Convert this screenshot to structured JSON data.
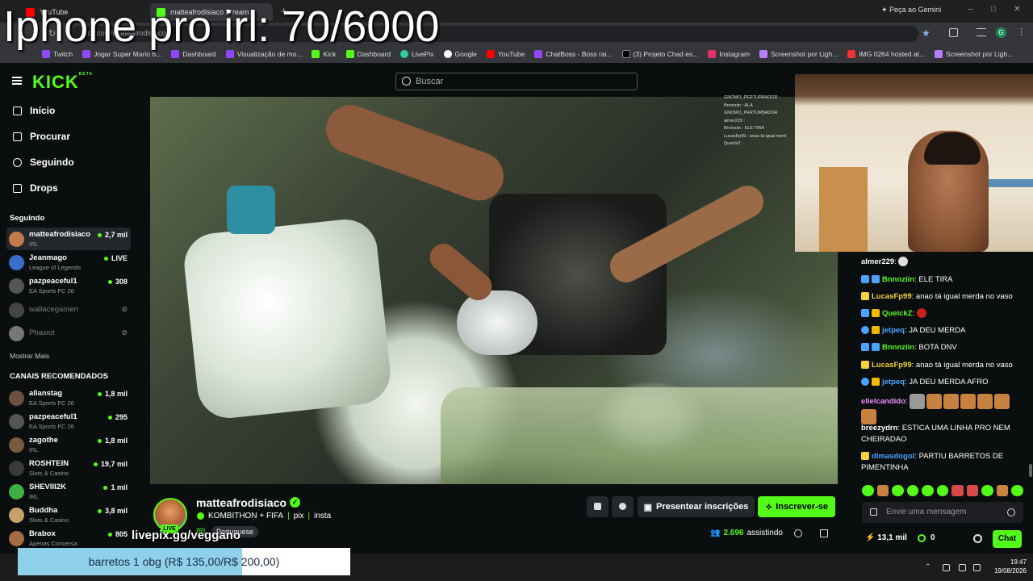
{
  "overlay_title": "Iphone pro irl: 70/6000",
  "browser": {
    "tabs": [
      {
        "label": "YouTube",
        "active": false
      },
      {
        "label": "matteafrodisiaco Stream",
        "active": true
      }
    ],
    "gemini_label": "Peça ao Gemini",
    "url": "kick.com/matteafrodisiaco",
    "bookmarks": [
      "Twitch",
      "Jogar Super Mario 6...",
      "Dashboard",
      "Visualização de mo...",
      "Kick",
      "Dashboard",
      "LivePix",
      "Google",
      "YouTube",
      "ChatBoss - Boss rai...",
      "(3) Projeto Chad es...",
      "Instagram",
      "Screenshot por Ligh...",
      "IMG 0264 hosted at...",
      "Screenshot por Ligh..."
    ]
  },
  "header": {
    "logo": "KICK",
    "logo_sup": "BETA",
    "search_placeholder": "Buscar"
  },
  "sidebar": {
    "nav": [
      {
        "label": "Início",
        "icon": "home-icon"
      },
      {
        "label": "Procurar",
        "icon": "browse-icon"
      },
      {
        "label": "Seguindo",
        "icon": "heart-icon"
      },
      {
        "label": "Drops",
        "icon": "drops-icon"
      }
    ],
    "following_title": "Seguindo",
    "following": [
      {
        "name": "matteafrodisiaco",
        "category": "IRL",
        "viewers": "2,7 mil",
        "active": true
      },
      {
        "name": "Jeanmago",
        "category": "League of Legends",
        "viewers": "LIVE"
      },
      {
        "name": "pazpeaceful1",
        "category": "EA Sports FC 26",
        "viewers": "308"
      },
      {
        "name": "wallacegamerr",
        "category": "",
        "viewers": "",
        "offline": true
      },
      {
        "name": "Phasiot",
        "category": "",
        "viewers": "",
        "offline": true
      }
    ],
    "show_more": "Mostrar Mais",
    "recommended_title": "CANAIS RECOMENDADOS",
    "recommended": [
      {
        "name": "allanstag",
        "category": "EA Sports FC 26",
        "viewers": "1,8 mil"
      },
      {
        "name": "pazpeaceful1",
        "category": "EA Sports FC 26",
        "viewers": "295"
      },
      {
        "name": "zagothe",
        "category": "IRL",
        "viewers": "1,8 mil"
      },
      {
        "name": "ROSHTEIN",
        "category": "Slots & Casino",
        "viewers": "19,7 mil"
      },
      {
        "name": "SHEVIII2K",
        "category": "IRL",
        "viewers": "1 mil"
      },
      {
        "name": "Buddha",
        "category": "Slots & Casino",
        "viewers": "3,8 mil"
      },
      {
        "name": "Brabox",
        "category": "Apenas Conversa",
        "viewers": "805"
      }
    ]
  },
  "video_overlay_chat": [
    "GNOMO_PERTURBADOR :",
    "Bnnnziin : ALA",
    "GNOMO_PERTURBADOR",
    "almer229 :",
    "Bnnnziin : ELE TIRA",
    "LucasFp99 : anao tá igual merd",
    "QueickZ :"
  ],
  "stream": {
    "streamer": "matteafrodisiaco",
    "title": "KOMBITHON + FIFA",
    "links": [
      "pix",
      "insta"
    ],
    "category": "IRL",
    "language": "Portuguese",
    "live_badge": "LIVE",
    "viewers_count": "2.696",
    "viewers_label": "assistindo",
    "gift_label": "Presentear inscrições",
    "subscribe_label": "Inscrever-se",
    "livepix_overlay": "livepix.gg/veggano"
  },
  "chat": {
    "messages": [
      {
        "user": "almer229",
        "text": "",
        "color": "#ffffff"
      },
      {
        "user": "Bnnnziin",
        "text": "ELE TIRA",
        "color": "#53fc18"
      },
      {
        "user": "LucasFp99",
        "text": "anao tá igual merda no vaso",
        "color": "#f5d33b"
      },
      {
        "user": "QueickZ",
        "text": "",
        "color": "#53fc18"
      },
      {
        "user": "jetpeq",
        "text": "JA DEU MERDA",
        "color": "#4aa3ff"
      },
      {
        "user": "Bnnnziin",
        "text": "BOTA DNV",
        "color": "#53fc18"
      },
      {
        "user": "LucasFp99",
        "text": "anao tá igual merda no vaso",
        "color": "#f5d33b"
      },
      {
        "user": "jetpeq",
        "text": "JA DEU MERDA AFRO",
        "color": "#4aa3ff"
      },
      {
        "user": "elielcandido",
        "text": "",
        "color": "#f08cff"
      },
      {
        "user": "breezydrn",
        "text": "ESTICA UMA LINHA PRO NEM CHEIRADAO",
        "color": "#ffffff"
      },
      {
        "user": "dimasdogol",
        "text": "PARTIU BARRETOS DE PIMENTINHA",
        "color": "#4aa3ff"
      }
    ],
    "input_placeholder": "Envie uma mensagem",
    "kicks": "13,1 mil",
    "points": "0",
    "chat_button": "Chat"
  },
  "donation_banner": "barretos 1 obg (R$ 135,00/R$ 200,00)",
  "donation_progress": 0.675,
  "taskbar": {
    "time": "19:47",
    "date": "19/08/2026"
  }
}
